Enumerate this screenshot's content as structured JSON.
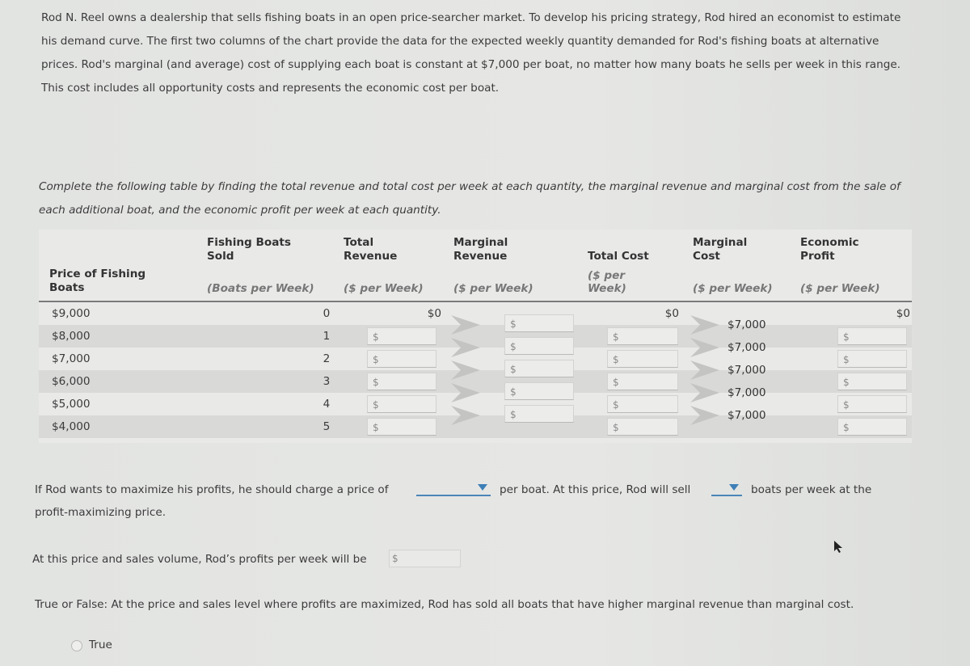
{
  "intro_text": "Rod N. Reel owns a dealership that sells fishing boats in an open price-searcher market. To develop his pricing strategy, Rod hired an economist to estimate his demand curve. The first two columns of the chart provide the data for the expected weekly quantity demanded for Rod's fishing boats at alternative prices. Rod's marginal (and average) cost of supplying each boat is constant at $7,000 per boat, no matter how many boats he sells per week in this range. This cost includes all opportunity costs and represents the economic cost per boat.",
  "instructions": "Complete the following table by finding the total revenue and total cost per week at each quantity, the marginal revenue and marginal cost from the sale of each additional boat, and the economic profit per week at each quantity.",
  "table": {
    "headers": {
      "price": "Price of Fishing Boats",
      "boats_sold": "Fishing Boats Sold",
      "boats_sold_unit": "(Boats per Week)",
      "total_revenue": "Total Revenue",
      "total_revenue_unit": "($ per Week)",
      "marginal_revenue": "Marginal Revenue",
      "marginal_revenue_unit": "($ per Week)",
      "total_cost": "Total Cost",
      "total_cost_unit": "($ per Week)",
      "marginal_cost": "Marginal Cost",
      "marginal_cost_unit": "($ per Week)",
      "economic_profit": "Economic Profit",
      "economic_profit_unit": "($ per Week)"
    },
    "rows": [
      {
        "price": "$9,000",
        "qty": "0",
        "total_revenue": "$0",
        "total_cost": "$0",
        "economic_profit": "$0"
      },
      {
        "price": "$8,000",
        "qty": "1",
        "total_revenue": "",
        "total_cost": "",
        "economic_profit": ""
      },
      {
        "price": "$7,000",
        "qty": "2",
        "total_revenue": "",
        "total_cost": "",
        "economic_profit": ""
      },
      {
        "price": "$6,000",
        "qty": "3",
        "total_revenue": "",
        "total_cost": "",
        "economic_profit": ""
      },
      {
        "price": "$5,000",
        "qty": "4",
        "total_revenue": "",
        "total_cost": "",
        "economic_profit": ""
      },
      {
        "price": "$4,000",
        "qty": "5",
        "total_revenue": "",
        "total_cost": "",
        "economic_profit": ""
      }
    ],
    "marginal_revenue": [
      "",
      "",
      "",
      "",
      ""
    ],
    "marginal_cost": [
      "$7,000",
      "$7,000",
      "$7,000",
      "$7,000",
      "$7,000"
    ],
    "input_prefix": "$"
  },
  "question1": {
    "part1": "If Rod wants to maximize his profits, he should charge a price of",
    "price_selected": "",
    "part2": "per boat. At this price, Rod will sell",
    "qty_selected": "",
    "part3": "boats per week at the",
    "part4": "profit-maximizing price."
  },
  "question2": {
    "text": "At this price and sales volume, Rod’s profits per week will be",
    "prefix": "$",
    "value": ""
  },
  "question3": {
    "text": "True or False: At the price and sales level where profits are maximized, Rod has sold all boats that have higher marginal revenue than marginal cost.",
    "options": [
      "True"
    ]
  },
  "colors": {
    "accent": "#3d7fb7",
    "header_rule": "#7a7a7a",
    "row_shade": "#d9dad8"
  }
}
